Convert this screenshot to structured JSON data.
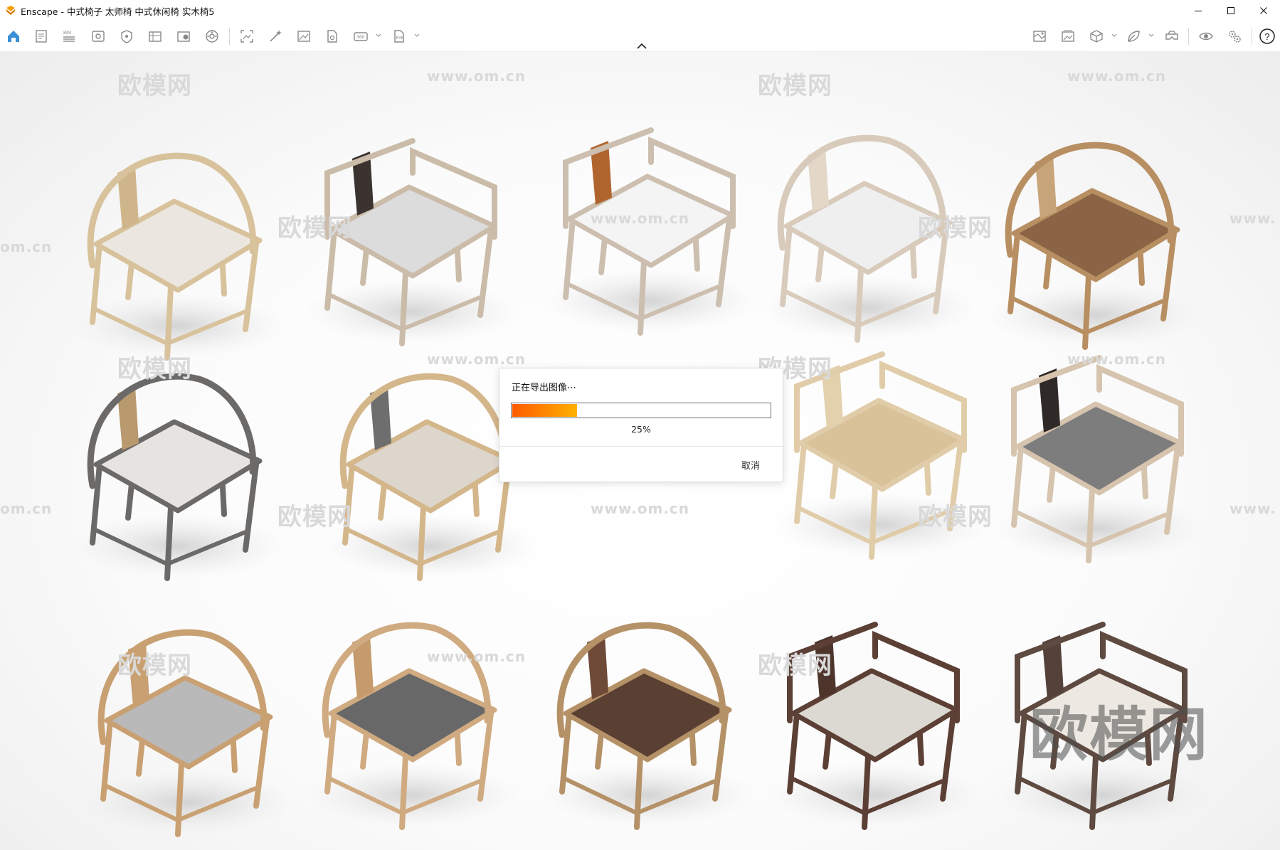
{
  "window": {
    "title": "Enscape - 中式椅子 太师椅 中式休闲椅 实木椅5",
    "controls": [
      "minimize-icon",
      "maximize-icon",
      "close-icon"
    ]
  },
  "toolbar": {
    "left_icons": [
      "home-icon",
      "bim-sheet-icon",
      "bim-list-icon",
      "view-icon",
      "safe-frame-icon",
      "material-library-icon",
      "asset-library-icon",
      "settings-wheel-icon",
      "screenshot-icon",
      "magic-wand-icon",
      "image-export-icon",
      "document-export-icon",
      "panorama-360-icon",
      "exe-export-icon"
    ],
    "right_icons": [
      "map-icon",
      "gallery-icon",
      "cube-icon",
      "leaf-icon",
      "vr-headset-icon",
      "eye-icon",
      "gears-icon",
      "help-icon"
    ],
    "help_label": "?"
  },
  "watermarks": {
    "brand": "欧模网",
    "domain": "www.om.cn",
    "domain_short": "om.cn",
    "domain_cut": "www."
  },
  "dialog": {
    "title": "正在导出图像⋯",
    "progress_percent": 25,
    "progress_label": "25%",
    "cancel_label": "取消"
  },
  "colors": {
    "accent": "#3a8fd8",
    "progress_start": "#ff5a00",
    "progress_end": "#ffb100",
    "logo": "#f5a000"
  }
}
